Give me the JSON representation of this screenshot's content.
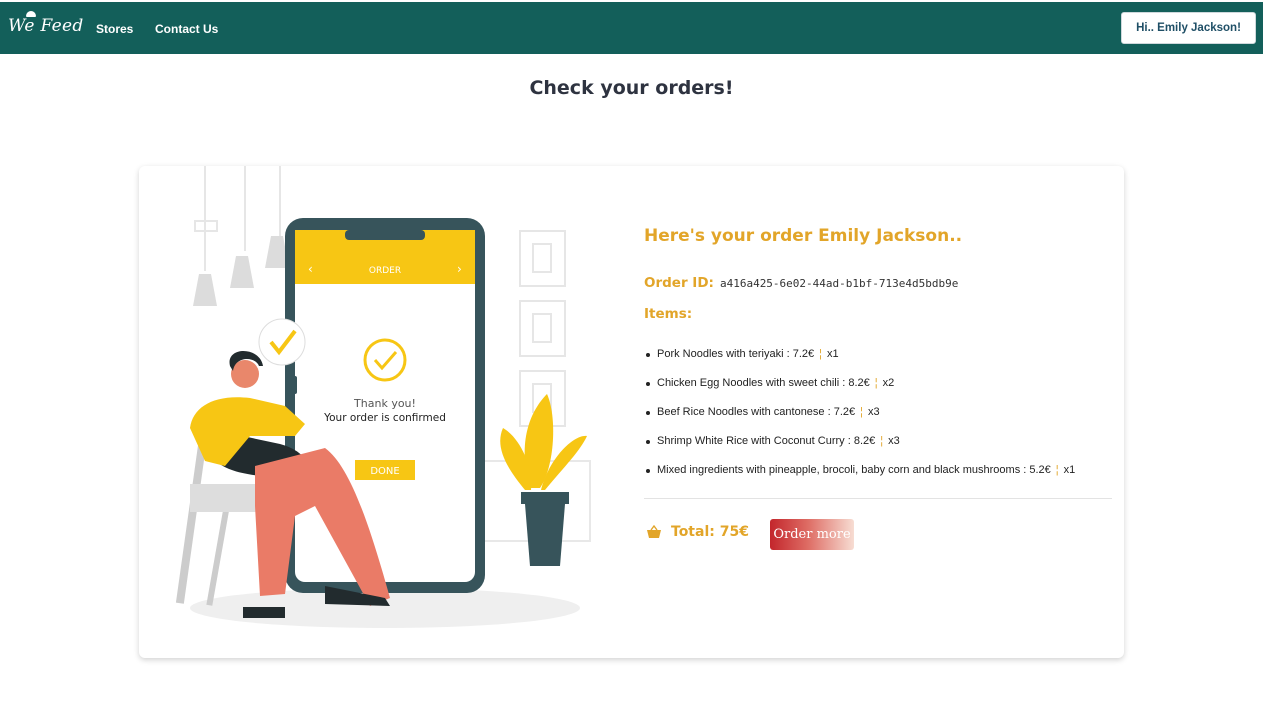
{
  "navbar": {
    "logo": "We Feed",
    "links": [
      "Stores",
      "Contact Us"
    ],
    "user_button": "Hi.. Emily Jackson!"
  },
  "page": {
    "title": "Check your orders!"
  },
  "illustration": {
    "screen_header": "ORDER",
    "thank_you": "Thank you!",
    "confirmed": "Your order is confirmed",
    "done_button": "DONE"
  },
  "order": {
    "heading": "Here's your order Emily Jackson..",
    "id_label": "Order ID:",
    "id_value": "a416a425-6e02-44ad-b1bf-713e4d5bdb9e",
    "items_label": "Items:",
    "items": [
      {
        "text": "Pork Noodles with teriyaki : 7.2€",
        "qty": "x1"
      },
      {
        "text": "Chicken Egg Noodles with sweet chili : 8.2€",
        "qty": "x2"
      },
      {
        "text": "Beef Rice Noodles with cantonese : 7.2€",
        "qty": "x3"
      },
      {
        "text": "Shrimp White Rice with Coconut Curry : 8.2€",
        "qty": "x3"
      },
      {
        "text": "Mixed ingredients with pineapple, brocoli, baby corn and black mushrooms : 5.2€",
        "qty": "x1"
      }
    ],
    "separator": "¦",
    "total": "Total: 75€",
    "order_more": "Order more"
  },
  "colors": {
    "navbar": "#135f5a",
    "accent": "#e2a529",
    "button": "#c3262c"
  },
  "icons": {
    "basket": "basket-icon",
    "checkmark": "checkmark-icon"
  }
}
